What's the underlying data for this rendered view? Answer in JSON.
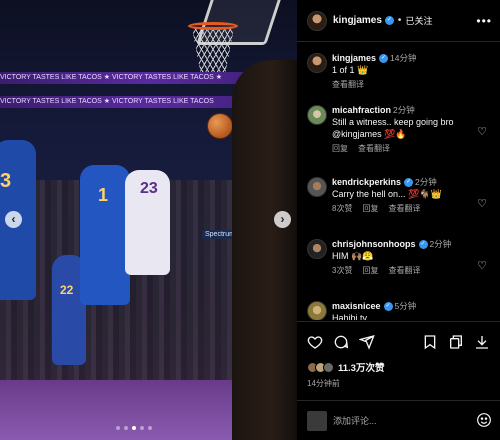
{
  "post": {
    "username": "kingjames",
    "follow_label": "已关注",
    "separator": "•"
  },
  "photo": {
    "banner_top_text": "VICTORY TASTES LIKE TACOS ★ VICTORY TASTES LIKE TACOS ★",
    "banner_mid_text": "VICTORY TASTES LIKE TACOS ★ VICTORY TASTES LIKE TACOS",
    "sign_text": "Spectrum",
    "jersey_numbers": [
      "23",
      "1",
      "3",
      "22"
    ],
    "carousel_count": 5,
    "carousel_active": 2
  },
  "comments": [
    {
      "username": "kingjames",
      "verified": true,
      "time": "14分钟",
      "text": "1 of 1 👑",
      "meta": [
        "查看翻译"
      ],
      "heart": false
    },
    {
      "username": "micahfraction",
      "verified": false,
      "time": "2分钟",
      "text": "Still a witness.. keep going bro @kingjames 💯🔥",
      "meta": [
        "回复",
        "查看翻译"
      ],
      "heart": true
    },
    {
      "username": "kendrickperkins",
      "verified": true,
      "time": "2分钟",
      "text": "Carry the hell on... 💯🐐👑",
      "meta": [
        "8次赞",
        "回复",
        "查看翻译"
      ],
      "heart": true
    },
    {
      "username": "chrisjohnsonhoops",
      "verified": true,
      "time": "2分钟",
      "text": "HIM 🙌🏽😤",
      "meta": [
        "3次赞",
        "回复",
        "查看翻译"
      ],
      "heart": true
    },
    {
      "username": "maxisnicee",
      "verified": true,
      "time": "5分钟",
      "text": "Hahibi tv",
      "meta": [],
      "heart": false
    }
  ],
  "actions": {
    "likes": "11.3万次赞",
    "posted_time": "14分钟前"
  },
  "add_comment": {
    "placeholder": "添加评论..."
  },
  "colors": {
    "verified": "#3897f0",
    "muted": "#a8a8a8",
    "background": "#000000"
  },
  "icons": [
    "heart-icon",
    "comment-icon",
    "share-icon",
    "bookmark-icon",
    "repost-icon",
    "download-icon",
    "emoji-icon",
    "more-icon"
  ]
}
